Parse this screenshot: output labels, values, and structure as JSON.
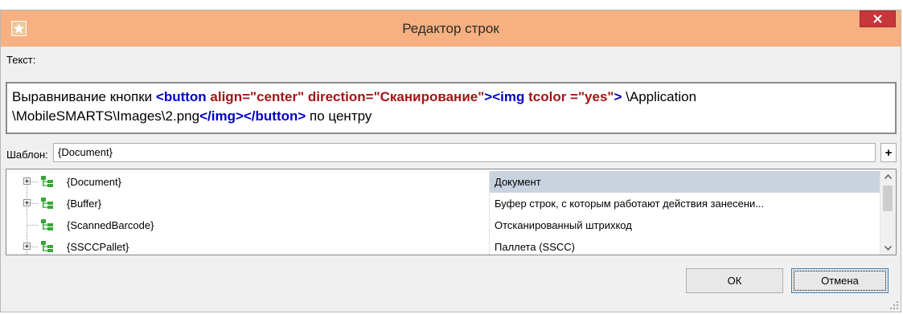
{
  "window": {
    "title": "Редактор строк"
  },
  "text_label": "Текст:",
  "text_content": {
    "prefix": "Выравнивание кнопки ",
    "tag1": "<button ",
    "attr1": "align=\"center\" direction=\"Сканирование\"",
    "tag2": "><img ",
    "attr2": "tcolor =\"yes\"",
    "tag3": ">",
    "path": " \\Application \\MobileSMARTS\\Images\\2.png",
    "tag4": "</img></button>",
    "suffix": " по центру"
  },
  "template": {
    "label": "Шаблон:",
    "value": "{Document}",
    "add_label": "+"
  },
  "tree": {
    "rows": [
      {
        "name": "{Document}",
        "desc": "Документ"
      },
      {
        "name": "{Buffer}",
        "desc": "Буфер строк, с которым работают действия занесени..."
      },
      {
        "name": "{ScannedBarcode}",
        "desc": "Отсканированный штрихкод"
      },
      {
        "name": "{SSCCPallet}",
        "desc": "Паллета (SSCC)"
      }
    ]
  },
  "buttons": {
    "ok": "ОК",
    "cancel": "Отмена"
  },
  "colors": {
    "titlebar": "#f6b081",
    "close": "#c7363b",
    "tag": "#0000c8",
    "attr": "#a31515",
    "selected": "#c9d3e0"
  }
}
